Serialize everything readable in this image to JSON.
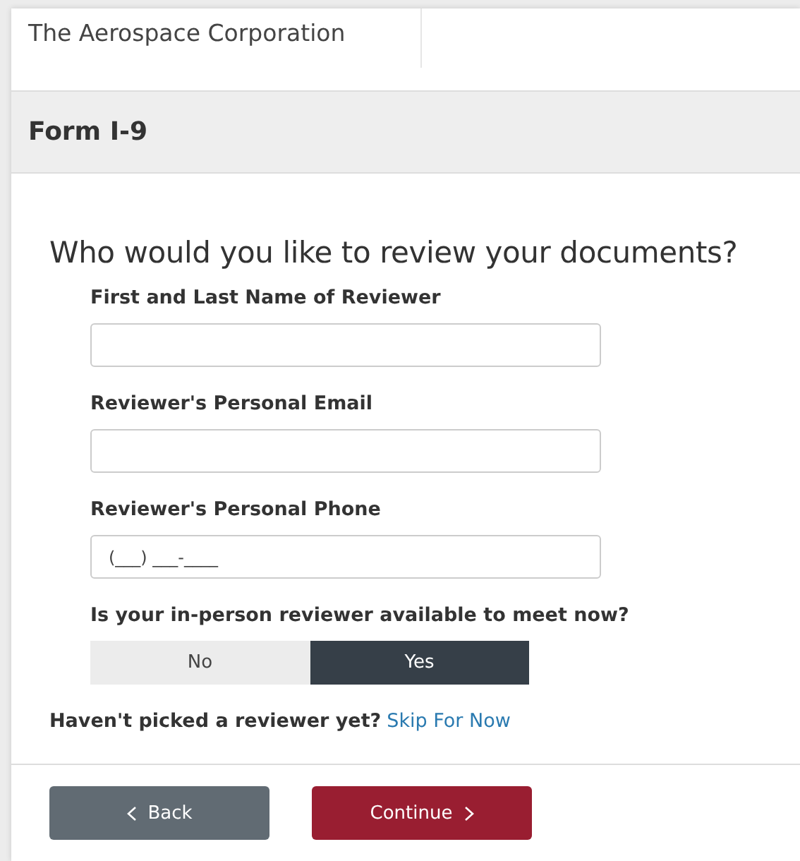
{
  "header": {
    "company": "The Aerospace Corporation"
  },
  "form_bar": {
    "title": "Form I-9"
  },
  "question": "Who would you like to review your documents?",
  "fields": [
    {
      "label": "First and Last Name of Reviewer"
    },
    {
      "label": "Reviewer's Personal Email"
    },
    {
      "label": "Reviewer's Personal Phone",
      "placeholder": "(___) ___-____"
    }
  ],
  "availability": {
    "label": "Is your in-person reviewer available to meet now?",
    "options": [
      {
        "label": "No",
        "selected": false
      },
      {
        "label": "Yes",
        "selected": true
      }
    ]
  },
  "skip": {
    "text": "Haven't picked a reviewer yet?",
    "link": "Skip For Now"
  },
  "buttons": [
    {
      "kind": "back",
      "label": "Back"
    },
    {
      "kind": "continue",
      "label": "Continue"
    }
  ]
}
